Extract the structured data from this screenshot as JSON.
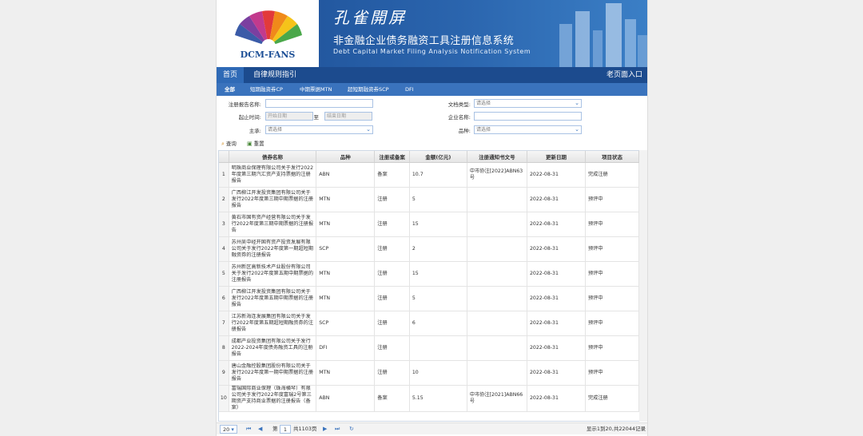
{
  "header": {
    "logo_text": "DCM-FANS",
    "brand_cn": "孔雀開屏",
    "system_title": "非金融企业债务融资工具注册信息系统",
    "system_subtitle": "Debt Capital Market Filing Analysis Notification System"
  },
  "nav": {
    "tabs": [
      "首页",
      "自律规则指引"
    ],
    "old_entry": "老页面入口"
  },
  "subnav": {
    "tabs": [
      "全部",
      "短期融资券CP",
      "中期票据MTN",
      "超短期融资券SCP",
      "DFI"
    ]
  },
  "filter": {
    "report_name_label": "注册报告名称:",
    "date_label": "起止时间:",
    "start_placeholder": "开始日期",
    "to_label": "至",
    "end_placeholder": "结束日期",
    "underwriter_label": "主承:",
    "underwriter_value": "请选择",
    "doc_type_label": "文档类型:",
    "doc_type_value": "请选择",
    "company_label": "企业名称:",
    "variety_label": "品种:",
    "variety_value": "请选择"
  },
  "toolbar": {
    "query_label": "查询",
    "reset_label": "重置"
  },
  "table": {
    "columns": [
      "债券名称",
      "品种",
      "注册或备案",
      "金额(亿元)",
      "注册通知书文号",
      "更新日期",
      "项目状态"
    ],
    "rows": [
      {
        "n": "1",
        "name": "明珠商业保理有限公司关于发行2022年度第三期汽汇资产支持票据的注册报告",
        "type": "ABN",
        "reg": "备案",
        "amount": "10.7",
        "notice": "中市协注[2022]ABN63号",
        "date": "2022-08-31",
        "status": "完成注册"
      },
      {
        "n": "2",
        "name": "广西柳江开发投资集团有限公司关于发行2022年度第三期中期票据的注册报告",
        "type": "MTN",
        "reg": "注册",
        "amount": "5",
        "notice": "",
        "date": "2022-08-31",
        "status": "预评中"
      },
      {
        "n": "3",
        "name": "黄石市国有资产经营有限公司关于发行2022年度第三期中期票据的注册报告",
        "type": "MTN",
        "reg": "注册",
        "amount": "15",
        "notice": "",
        "date": "2022-08-31",
        "status": "预评中"
      },
      {
        "n": "4",
        "name": "苏州吴中经开国有资产投资发展有限公司关于发行2022年度第一期超短期融资券的注册报告",
        "type": "SCP",
        "reg": "注册",
        "amount": "2",
        "notice": "",
        "date": "2022-08-31",
        "status": "预评中"
      },
      {
        "n": "5",
        "name": "苏州新区高新技术产业股份有限公司关于发行2022年度第五期中期票据的注册报告",
        "type": "MTN",
        "reg": "注册",
        "amount": "15",
        "notice": "",
        "date": "2022-08-31",
        "status": "预评中"
      },
      {
        "n": "6",
        "name": "广西柳江开发投资集团有限公司关于发行2022年度第五期中期票据的注册报告",
        "type": "MTN",
        "reg": "注册",
        "amount": "5",
        "notice": "",
        "date": "2022-08-31",
        "status": "预评中"
      },
      {
        "n": "7",
        "name": "江苏新海连发展集团有限公司关于发行2022年度第五期超短期融资券的注册报告",
        "type": "SCP",
        "reg": "注册",
        "amount": "6",
        "notice": "",
        "date": "2022-08-31",
        "status": "预评中"
      },
      {
        "n": "8",
        "name": "成都产业投资集团有限公司关于发行2022-2024年度债务融资工具的注册报告",
        "type": "DFI",
        "reg": "注册",
        "amount": "",
        "notice": "",
        "date": "2022-08-31",
        "status": "预评中"
      },
      {
        "n": "9",
        "name": "唐山金融控股集团股份有限公司关于发行2022年度第一期中期票据的注册报告",
        "type": "MTN",
        "reg": "注册",
        "amount": "10",
        "notice": "",
        "date": "2022-08-31",
        "status": "预评中"
      },
      {
        "n": "10",
        "name": "富瑞国际商业保理（珠海横琴）有限公司关于发行2022年度富瑞2号第三期资产支持商业票据的注册报告（备案）",
        "type": "ABN",
        "reg": "备案",
        "amount": "5.15",
        "notice": "中市协注[2021]ABN66号",
        "date": "2022-08-31",
        "status": "完成注册"
      }
    ]
  },
  "pager": {
    "page_size": "20",
    "page_prefix": "第",
    "page_value": "1",
    "page_suffix": "共1103页",
    "summary": "显示1到20,共22044记录"
  }
}
